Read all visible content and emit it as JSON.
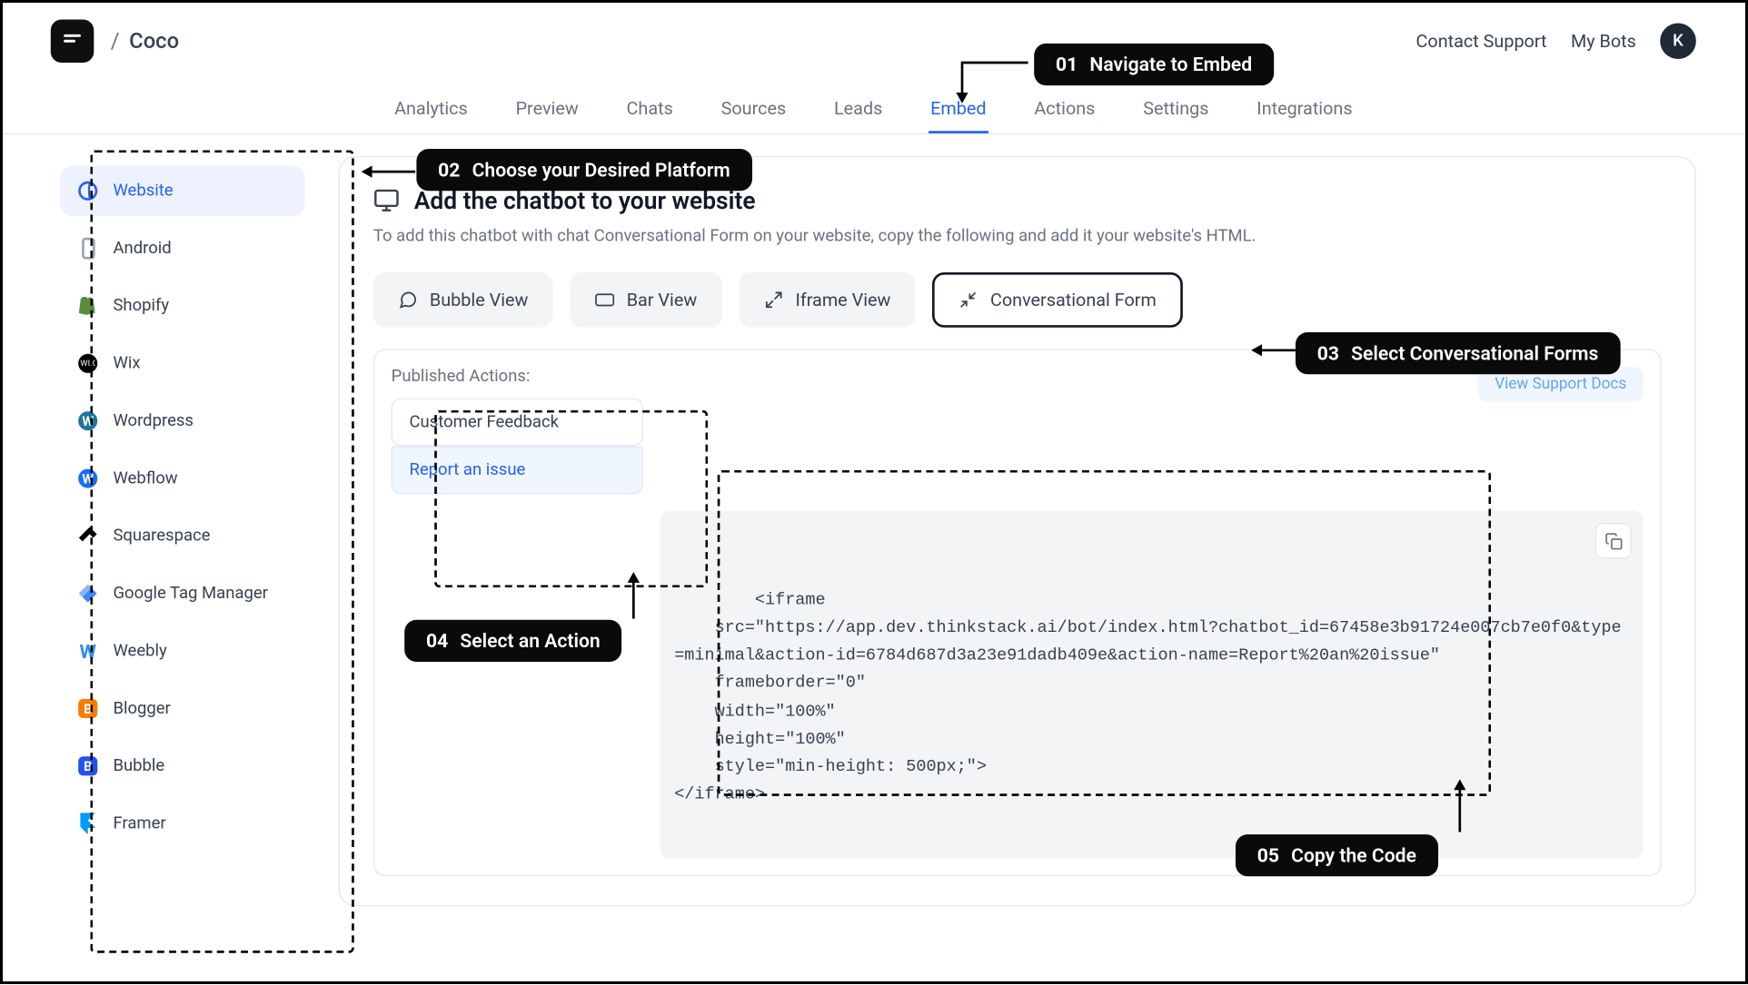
{
  "breadcrumb": {
    "title": "Coco"
  },
  "header": {
    "contact": "Contact Support",
    "mybots": "My Bots",
    "avatar_initial": "K"
  },
  "tabs": [
    {
      "label": "Analytics"
    },
    {
      "label": "Preview"
    },
    {
      "label": "Chats"
    },
    {
      "label": "Sources"
    },
    {
      "label": "Leads"
    },
    {
      "label": "Embed",
      "active": true
    },
    {
      "label": "Actions"
    },
    {
      "label": "Settings"
    },
    {
      "label": "Integrations"
    }
  ],
  "sidebar": {
    "items": [
      {
        "label": "Website",
        "active": true
      },
      {
        "label": "Android"
      },
      {
        "label": "Shopify"
      },
      {
        "label": "Wix"
      },
      {
        "label": "Wordpress"
      },
      {
        "label": "Webflow"
      },
      {
        "label": "Squarespace"
      },
      {
        "label": "Google Tag Manager"
      },
      {
        "label": "Weebly"
      },
      {
        "label": "Blogger"
      },
      {
        "label": "Bubble"
      },
      {
        "label": "Framer"
      }
    ]
  },
  "main": {
    "heading": "Add the chatbot to your website",
    "desc": "To add this chatbot with chat Conversational Form on your website, copy the following and add it your website's HTML.",
    "view_buttons": {
      "bubble": "Bubble View",
      "bar": "Bar View",
      "iframe": "Iframe View",
      "conv": "Conversational Form"
    },
    "actions_title": "Published Actions:",
    "actions": {
      "feedback": "Customer Feedback",
      "issue": "Report an issue"
    },
    "docs_link": "View Support Docs",
    "code": "<iframe\n    src=\"https://app.dev.thinkstack.ai/bot/index.html?chatbot_id=67458e3b91724e007cb7e0f0&type=minimal&action-id=6784d687d3a23e91dadb409e&action-name=Report%20an%20issue\"\n    frameborder=\"0\"\n    width=\"100%\"\n    height=\"100%\"\n    style=\"min-height: 500px;\">\n</iframe>"
  },
  "annotations": {
    "a1": {
      "num": "01",
      "text": "Navigate to Embed"
    },
    "a2": {
      "num": "02",
      "text": "Choose your Desired Platform"
    },
    "a3": {
      "num": "03",
      "text": "Select Conversational Forms"
    },
    "a4": {
      "num": "04",
      "text": "Select an Action"
    },
    "a5": {
      "num": "05",
      "text": "Copy the Code"
    }
  }
}
